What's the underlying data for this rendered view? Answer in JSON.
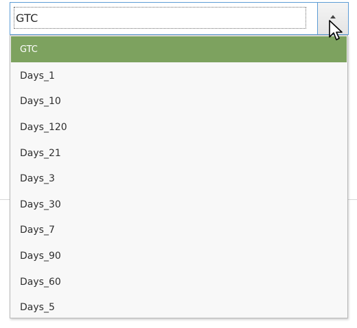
{
  "combo": {
    "value": "GTC",
    "button_icon": "arrow-up-icon"
  },
  "dropdown": {
    "selected_index": 0,
    "items": [
      {
        "label": "GTC"
      },
      {
        "label": "Days_1"
      },
      {
        "label": "Days_10"
      },
      {
        "label": "Days_120"
      },
      {
        "label": "Days_21"
      },
      {
        "label": "Days_3"
      },
      {
        "label": "Days_30"
      },
      {
        "label": "Days_7"
      },
      {
        "label": "Days_90"
      },
      {
        "label": "Days_60"
      },
      {
        "label": "Days_5"
      }
    ]
  },
  "colors": {
    "selected_bg": "#7da25f",
    "focus_border": "#5b9bd5",
    "list_bg": "#f8f8f8"
  }
}
